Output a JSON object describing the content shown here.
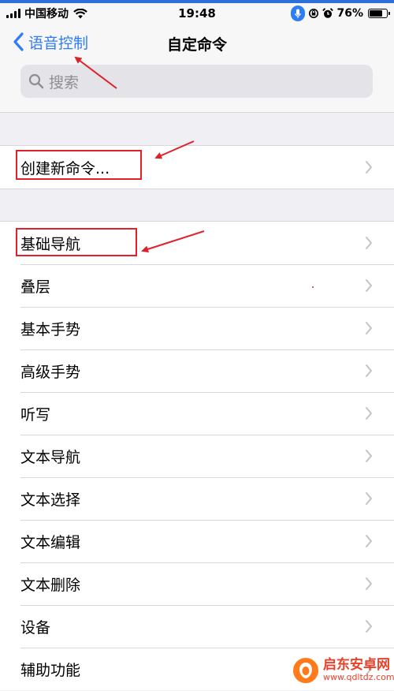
{
  "status_bar": {
    "carrier": "中国移动",
    "time": "19:48",
    "battery_percent": "76%",
    "battery_level": 0.76,
    "icons": [
      "signal-icon",
      "wifi-icon",
      "microphone-icon",
      "lock-rotation-icon",
      "alarm-icon",
      "battery-icon"
    ]
  },
  "nav": {
    "back_label": "语音控制",
    "title": "自定命令"
  },
  "search": {
    "placeholder": "搜索"
  },
  "create_group": {
    "items": [
      {
        "label": "创建新命令..."
      }
    ]
  },
  "commands_group": {
    "items": [
      {
        "label": "基础导航"
      },
      {
        "label": "叠层"
      },
      {
        "label": "基本手势"
      },
      {
        "label": "高级手势"
      },
      {
        "label": "听写"
      },
      {
        "label": "文本导航"
      },
      {
        "label": "文本选择"
      },
      {
        "label": "文本编辑"
      },
      {
        "label": "文本删除"
      },
      {
        "label": "设备"
      },
      {
        "label": "辅助功能"
      }
    ]
  },
  "watermark": {
    "name": "启东安卓网",
    "url": "www.qdltdz.com"
  },
  "colors": {
    "accent": "#2f7cf6",
    "annotation": "#e0202a",
    "background": "#efeff4"
  }
}
